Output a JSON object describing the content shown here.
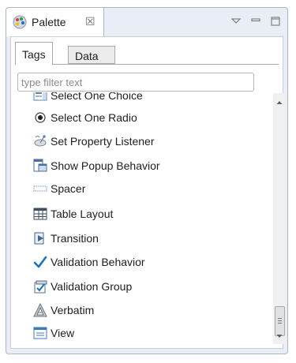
{
  "view": {
    "title": "Palette",
    "close_glyph": "☒"
  },
  "tabs": [
    {
      "label": "Tags",
      "active": true
    },
    {
      "label": "Data",
      "active": false
    }
  ],
  "filter": {
    "placeholder": "type filter text",
    "value": ""
  },
  "items": [
    {
      "label": "Select One Choice",
      "icon": "select-one-choice-icon"
    },
    {
      "label": "Select One Radio",
      "icon": "radio-icon"
    },
    {
      "label": "Set Property Listener",
      "icon": "satellite-icon"
    },
    {
      "label": "Show Popup Behavior",
      "icon": "popup-icon"
    },
    {
      "label": "Spacer",
      "icon": "spacer-icon"
    },
    {
      "label": "Table Layout",
      "icon": "table-layout-icon"
    },
    {
      "label": "Transition",
      "icon": "transition-icon"
    },
    {
      "label": "Validation Behavior",
      "icon": "checkmark-icon"
    },
    {
      "label": "Validation Group",
      "icon": "validation-group-icon"
    },
    {
      "label": "Verbatim",
      "icon": "verbatim-icon"
    },
    {
      "label": "View",
      "icon": "view-icon"
    }
  ],
  "colors": {
    "accent": "#1e6fbf",
    "border": "#a7b6c9",
    "view_bg": "#e9eef6"
  }
}
